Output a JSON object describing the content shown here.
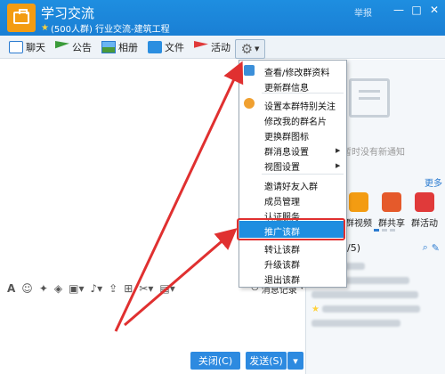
{
  "header": {
    "group_name": "学习交流",
    "group_info": "(500人群) 行业交流-建筑工程",
    "report": "举报",
    "minimize": "—",
    "maximize": "□",
    "close": "✕"
  },
  "toolbar": {
    "items": [
      {
        "label": "聊天",
        "icon": "chat-icon"
      },
      {
        "label": "公告",
        "icon": "announcement-icon"
      },
      {
        "label": "相册",
        "icon": "album-icon"
      },
      {
        "label": "文件",
        "icon": "folder-icon"
      },
      {
        "label": "活动",
        "icon": "activity-flag-icon"
      }
    ],
    "settings_icon": "gear-icon"
  },
  "menu": {
    "items": [
      {
        "label": "查看/修改群资料",
        "submenu": false
      },
      {
        "label": "更新群信息",
        "submenu": false
      },
      {
        "label": "设置本群特别关注",
        "submenu": false
      },
      {
        "label": "修改我的群名片",
        "submenu": false
      },
      {
        "label": "更换群图标",
        "submenu": false
      },
      {
        "label": "群消息设置",
        "submenu": true
      },
      {
        "label": "视图设置",
        "submenu": true
      },
      {
        "label": "邀请好友入群",
        "submenu": false
      },
      {
        "label": "成员管理",
        "submenu": false
      },
      {
        "label": "认证服务",
        "submenu": false
      },
      {
        "label": "推广该群",
        "submenu": false,
        "highlighted": true
      },
      {
        "label": "转让该群",
        "submenu": false
      },
      {
        "label": "升级该群",
        "submenu": false
      },
      {
        "label": "退出该群",
        "submenu": false
      }
    ]
  },
  "input_toolbar": {
    "history": "消息记录",
    "history_arrow": "▾"
  },
  "buttons": {
    "close": "关闭(C)",
    "send": "发送(S)",
    "send_arrow": "▾"
  },
  "right_panel": {
    "no_notice": "暂时没有新通知",
    "more": "更多",
    "apps": [
      {
        "label": "群视频",
        "color": "#f39c12"
      },
      {
        "label": "群共享",
        "color": "#e55a2b"
      },
      {
        "label": "群活动",
        "color": "#e03a3a"
      }
    ],
    "members_count": "/5)"
  },
  "colors": {
    "header": "#1e8ee0",
    "highlight": "#1e8ee0",
    "annotation": "#e03030"
  }
}
